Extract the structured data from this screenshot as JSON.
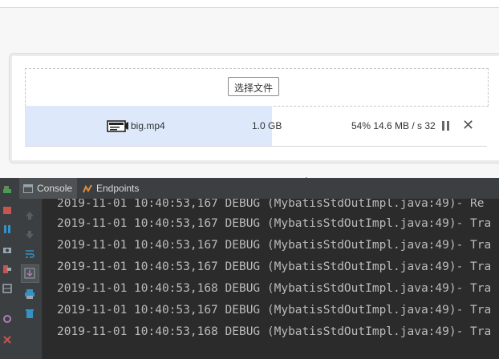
{
  "uploader": {
    "pick_button_label": "选择文件",
    "file": {
      "name": "big.mp4",
      "size": "1.0 GB",
      "percent": "54%",
      "speed": "14.6 MB / s",
      "remaining": "32",
      "progress_fraction": 0.54
    },
    "status_line": "54% 14.6 MB / s 32"
  },
  "ide": {
    "tabs": [
      {
        "label": "Console",
        "active": true
      },
      {
        "label": "Endpoints",
        "active": false
      }
    ],
    "log_lines": [
      "2019-11-01 10:40:53,167 DEBUG (MybatisStdOutImpl.java:49)- Re",
      "2019-11-01 10:40:53,167 DEBUG (MybatisStdOutImpl.java:49)- Tra",
      "2019-11-01 10:40:53,167 DEBUG (MybatisStdOutImpl.java:49)- Tra",
      "2019-11-01 10:40:53,167 DEBUG (MybatisStdOutImpl.java:49)- Tra",
      "2019-11-01 10:40:53,168 DEBUG (MybatisStdOutImpl.java:49)- Tra",
      "2019-11-01 10:40:53,167 DEBUG (MybatisStdOutImpl.java:49)- Tra",
      "2019-11-01 10:40:53,168 DEBUG (MybatisStdOutImpl.java:49)- Tra"
    ]
  },
  "colors": {
    "progress_fill": "#dde9fb",
    "console_bg": "#2b2b2b",
    "console_text": "#bbbbbb",
    "tool_bg": "#3c3f41"
  },
  "icons": {
    "file": "video-file-icon",
    "pause": "pause-icon",
    "close": "close-icon",
    "console_tab": "console-icon",
    "endpoints_tab": "endpoints-icon"
  }
}
